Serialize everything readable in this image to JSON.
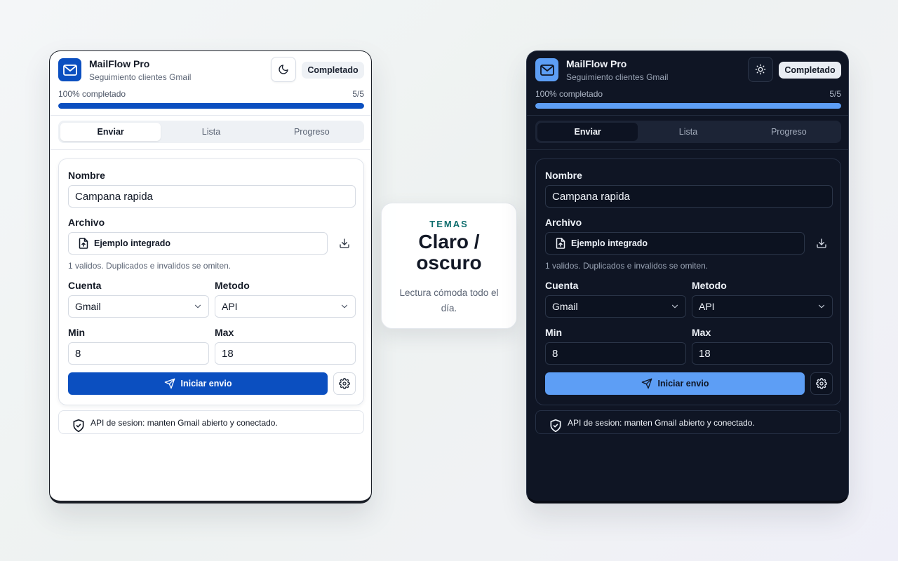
{
  "colors": {
    "light_accent": "#0b4fc0",
    "dark_accent": "#5d9ef5",
    "dark_background": "#0f1524",
    "theme_kicker": "#0f6e6e"
  },
  "panels": {
    "light": {
      "theme": "light",
      "theme_toggle_icon": "moon-icon",
      "header": {
        "title": "MailFlow Pro",
        "subtitle": "Seguimiento clientes Gmail",
        "status": "Completado"
      },
      "progress": {
        "label": "100% completado",
        "count": "5/5",
        "value": 1.0
      },
      "tabs": [
        "Enviar",
        "Lista",
        "Progreso"
      ],
      "active_tab": "Enviar",
      "form": {
        "name_label": "Nombre",
        "name_value": "Campana rapida",
        "file_label": "Archivo",
        "file_button": "Ejemplo integrado",
        "file_hint": "1 validos. Duplicados e invalidos se omiten.",
        "account_label": "Cuenta",
        "account_value": "Gmail",
        "method_label": "Metodo",
        "method_value": "API",
        "min_label": "Min",
        "min_value": "8",
        "max_label": "Max",
        "max_value": "18",
        "submit_label": "Iniciar envio"
      },
      "notice": "API de sesion: manten Gmail abierto y conectado."
    },
    "dark": {
      "theme": "dark",
      "theme_toggle_icon": "sun-icon",
      "header": {
        "title": "MailFlow Pro",
        "subtitle": "Seguimiento clientes Gmail",
        "status": "Completado"
      },
      "progress": {
        "label": "100% completado",
        "count": "5/5",
        "value": 1.0
      },
      "tabs": [
        "Enviar",
        "Lista",
        "Progreso"
      ],
      "active_tab": "Enviar",
      "form": {
        "name_label": "Nombre",
        "name_value": "Campana rapida",
        "file_label": "Archivo",
        "file_button": "Ejemplo integrado",
        "file_hint": "1 validos. Duplicados e invalidos se omiten.",
        "account_label": "Cuenta",
        "account_value": "Gmail",
        "method_label": "Metodo",
        "method_value": "API",
        "min_label": "Min",
        "min_value": "8",
        "max_label": "Max",
        "max_value": "18",
        "submit_label": "Iniciar envio"
      },
      "notice": "API de sesion: manten Gmail abierto y conectado."
    }
  },
  "center_card": {
    "kicker": "TEMAS",
    "title_line1": "Claro /",
    "title_line2": "oscuro",
    "subtitle": "Lectura cómoda todo el día."
  }
}
